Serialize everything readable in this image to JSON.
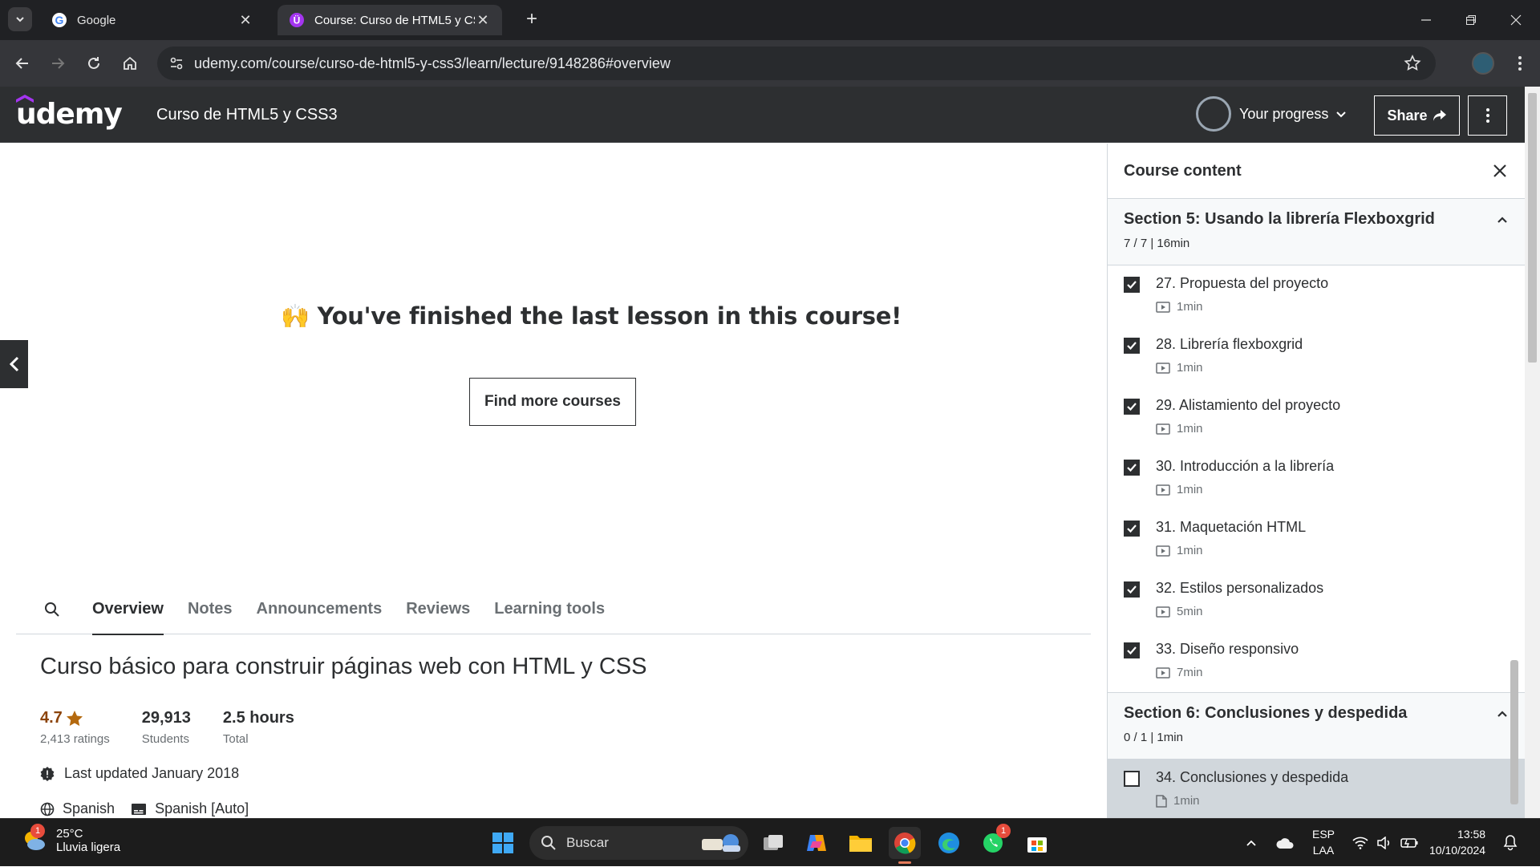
{
  "browser": {
    "tabs": [
      {
        "title": "Google",
        "icon": "google-icon"
      },
      {
        "title": "Course: Curso de HTML5 y CSS3",
        "icon": "udemy-icon"
      }
    ],
    "url": "udemy.com/course/curso-de-html5-y-css3/learn/lecture/9148286#overview"
  },
  "header": {
    "logo": "udemy",
    "course_title": "Curso de HTML5 y CSS3",
    "progress_label": "Your progress",
    "share_label": "Share"
  },
  "main": {
    "finished_emoji": "🙌",
    "finished_text": "You've finished the last lesson in this course!",
    "find_more_label": "Find more courses",
    "tabs": [
      "Overview",
      "Notes",
      "Announcements",
      "Reviews",
      "Learning tools"
    ],
    "active_tab": "Overview",
    "description": "Curso básico para construir páginas web con HTML y CSS",
    "rating": {
      "value": "4.7",
      "label": "2,413 ratings"
    },
    "students": {
      "value": "29,913",
      "label": "Students"
    },
    "duration": {
      "value": "2.5 hours",
      "label": "Total"
    },
    "last_updated": "Last updated January 2018",
    "language": "Spanish",
    "captions": "Spanish [Auto]"
  },
  "sidebar": {
    "title": "Course content",
    "section5": {
      "title": "Section 5: Usando la librería Flexboxgrid",
      "summary": "7 / 7 | 16min"
    },
    "items": [
      {
        "title": "27. Propuesta del proyecto",
        "duration": "1min",
        "checked": true
      },
      {
        "title": "28. Librería flexboxgrid",
        "duration": "1min",
        "checked": true
      },
      {
        "title": "29. Alistamiento del proyecto",
        "duration": "1min",
        "checked": true
      },
      {
        "title": "30. Introducción a la librería",
        "duration": "1min",
        "checked": true
      },
      {
        "title": "31. Maquetación HTML",
        "duration": "1min",
        "checked": true
      },
      {
        "title": "32. Estilos personalizados",
        "duration": "5min",
        "checked": true
      },
      {
        "title": "33. Diseño responsivo",
        "duration": "7min",
        "checked": true
      }
    ],
    "section6": {
      "title": "Section 6: Conclusiones y despedida",
      "summary": "0 / 1 | 1min"
    },
    "last_item": {
      "title": "34. Conclusiones y despedida",
      "duration": "1min",
      "checked": false
    }
  },
  "taskbar": {
    "temperature": "25°C",
    "weather": "Lluvia ligera",
    "weather_badge": "1",
    "search_placeholder": "Buscar",
    "whatsapp_badge": "1",
    "lang_top": "ESP",
    "lang_bottom": "LAA",
    "time": "13:58",
    "date": "10/10/2024"
  }
}
